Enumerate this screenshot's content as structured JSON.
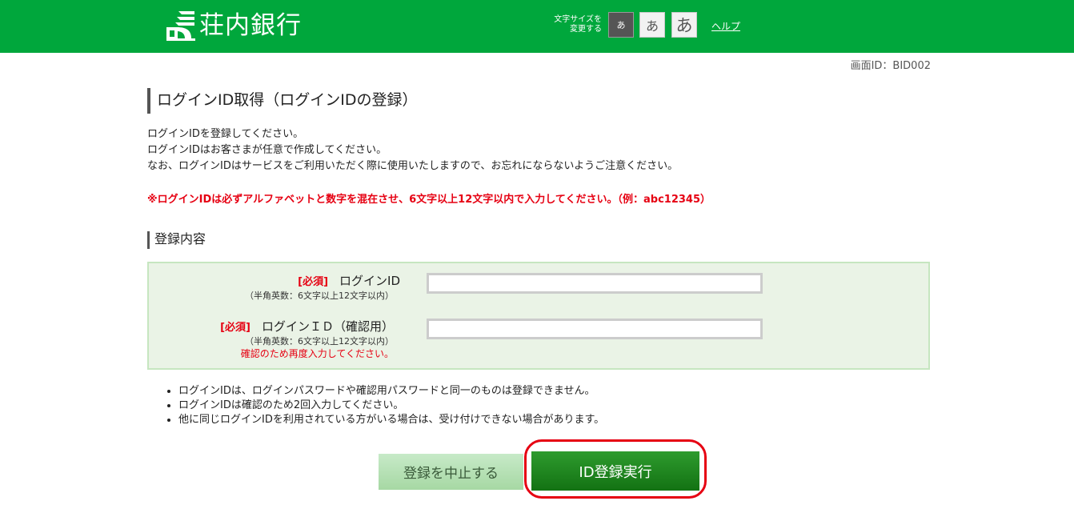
{
  "header": {
    "bank_name": "荘内銀行",
    "font_size_label_line1": "文字サイズを",
    "font_size_label_line2": "変更する",
    "font_small": "あ",
    "font_medium": "あ",
    "font_large": "あ",
    "help": "ヘルプ",
    "colors": {
      "brand": "#00a73c",
      "warning": "#e60012"
    },
    "icons": {
      "logo": "bank-logo-icon"
    }
  },
  "screen_id": "画面ID：BID002",
  "title": "ログインID取得（ログインIDの登録）",
  "intro": [
    "ログインIDを登録してください。",
    "ログインIDはお客さまが任意で作成してください。",
    "なお、ログインIDはサービスをご利用いただく際に使用いたしますので、お忘れにならないようご注意ください。"
  ],
  "warning": "※ログインIDは必ずアルファベットと数字を混在させ、6文字以上12文字以内で入力してください。（例：abc12345）",
  "section_title": "登録内容",
  "form": {
    "login_id": {
      "required": "[必須]",
      "label": "ログインID",
      "hint": "（半角英数：6文字以上12文字以内）",
      "value": ""
    },
    "login_id_confirm": {
      "required": "[必須]",
      "label": "ログインＩＤ（確認用）",
      "hint": "（半角英数：6文字以上12文字以内）",
      "note": "確認のため再度入力してください。",
      "value": ""
    }
  },
  "notes": [
    "ログインIDは、ログインパスワードや確認用パスワードと同一のものは登録できません。",
    "ログインIDは確認のため2回入力してください。",
    "他に同じログインIDを利用されている方がいる場合は、受け付けできない場合があります。"
  ],
  "buttons": {
    "cancel": "登録を中止する",
    "submit": "ID登録実行"
  }
}
